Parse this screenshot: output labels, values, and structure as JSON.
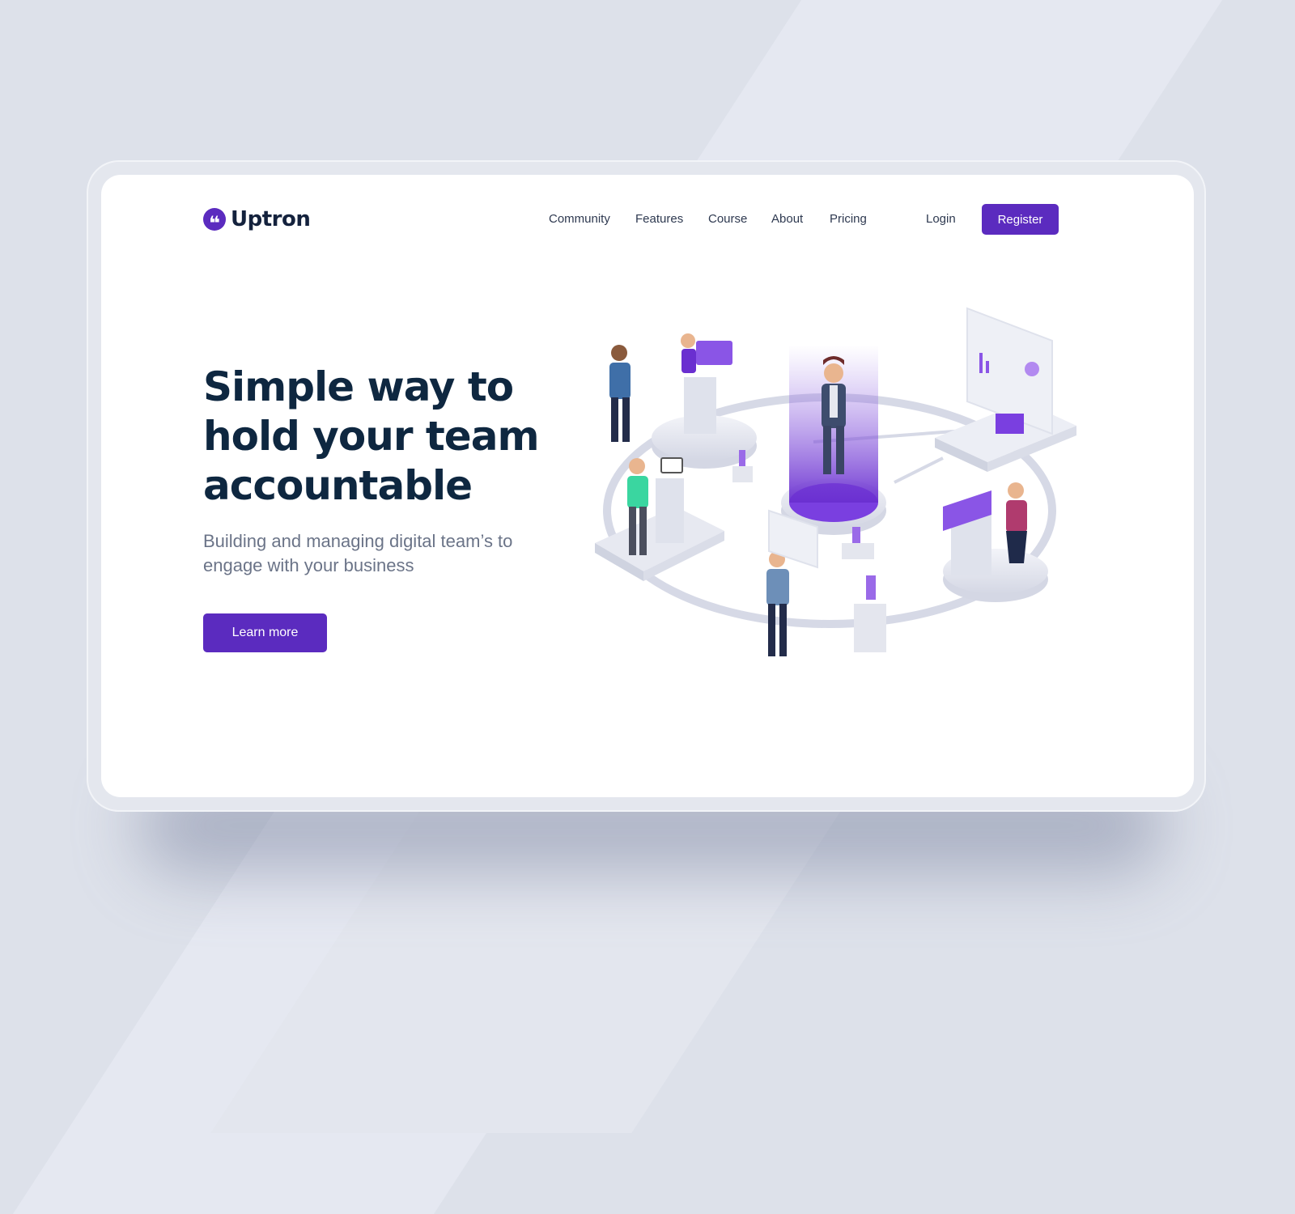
{
  "brand": {
    "name": "Uptron",
    "logo_glyph": "❝",
    "color": "#5b2bbf"
  },
  "nav": {
    "items": [
      {
        "label": "Community"
      },
      {
        "label": "Features"
      },
      {
        "label": "Course"
      },
      {
        "label": "About"
      },
      {
        "label": "Pricing"
      }
    ],
    "login_label": "Login",
    "register_label": "Register"
  },
  "hero": {
    "headline_lines": [
      "Simple way to",
      "hold your team",
      "accountable"
    ],
    "subtext": "Building and managing digital team’s to engage with your business",
    "cta_label": "Learn more"
  },
  "illustration": {
    "description_icon": "isometric-team-illustration-icon"
  },
  "colors": {
    "accent": "#5b2bbf",
    "heading": "#0e2740",
    "body_text": "#6b7488",
    "background": "#dde1ea"
  }
}
